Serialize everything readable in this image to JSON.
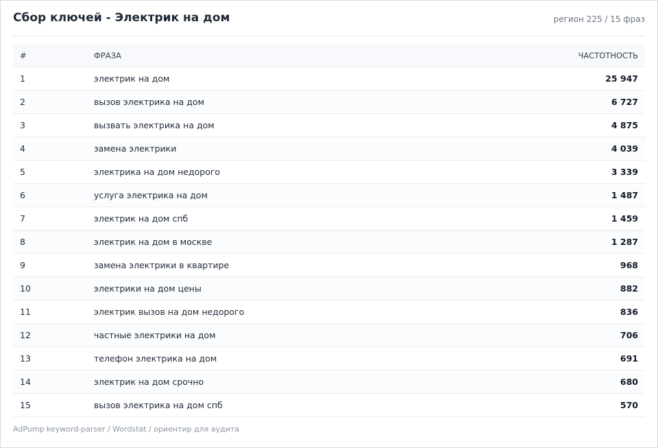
{
  "header": {
    "title": "Сбор ключей - Электрик на дом",
    "meta": "регион 225 / 15 фраз"
  },
  "table": {
    "columns": {
      "num": "#",
      "phrase": "ФРАЗА",
      "frequency": "ЧАСТОТНОСТЬ"
    },
    "rows": [
      {
        "num": "1",
        "phrase": "электрик на дом",
        "frequency": "25 947"
      },
      {
        "num": "2",
        "phrase": "вызов электрика на дом",
        "frequency": "6 727"
      },
      {
        "num": "3",
        "phrase": "вызвать электрика на дом",
        "frequency": "4 875"
      },
      {
        "num": "4",
        "phrase": "замена электрики",
        "frequency": "4 039"
      },
      {
        "num": "5",
        "phrase": "электрика на дом недорого",
        "frequency": "3 339"
      },
      {
        "num": "6",
        "phrase": "услуга электрика на дом",
        "frequency": "1 487"
      },
      {
        "num": "7",
        "phrase": "электрик на дом спб",
        "frequency": "1 459"
      },
      {
        "num": "8",
        "phrase": "электрик на дом в москве",
        "frequency": "1 287"
      },
      {
        "num": "9",
        "phrase": "замена электрики в квартире",
        "frequency": "968"
      },
      {
        "num": "10",
        "phrase": "электрики на дом цены",
        "frequency": "882"
      },
      {
        "num": "11",
        "phrase": "электрик вызов на дом недорого",
        "frequency": "836"
      },
      {
        "num": "12",
        "phrase": "частные электрики на дом",
        "frequency": "706"
      },
      {
        "num": "13",
        "phrase": "телефон электрика на дом",
        "frequency": "691"
      },
      {
        "num": "14",
        "phrase": "электрик на дом срочно",
        "frequency": "680"
      },
      {
        "num": "15",
        "phrase": "вызов электрика на дом спб",
        "frequency": "570"
      }
    ]
  },
  "footer": {
    "text": "AdPump keyword-parser / Wordstat / ориентир для аудита"
  }
}
